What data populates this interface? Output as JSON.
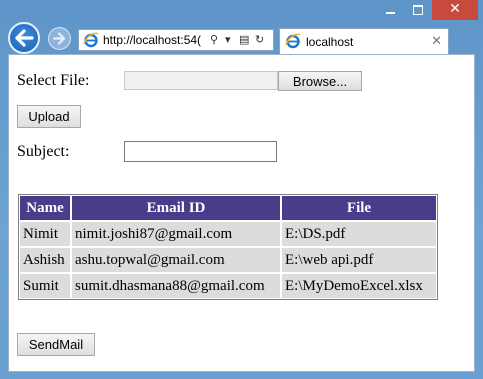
{
  "browser": {
    "url": "http://localhost:54(",
    "url_host": "http://localhost:54(",
    "tab_title": "localhost",
    "window_controls": {
      "minimize": "–",
      "maximize": "□",
      "close": "✕"
    },
    "icons": [
      "back-arrow-icon",
      "forward-arrow-icon",
      "ie-logo-icon",
      "search-icon",
      "dropdown-icon",
      "compat-view-icon",
      "refresh-icon",
      "close-icon"
    ]
  },
  "form": {
    "select_file_label": "Select File:",
    "browse_label": "Browse...",
    "file_value": "",
    "upload_label": "Upload",
    "subject_label": "Subject:",
    "subject_value": "",
    "send_label": "SendMail"
  },
  "table": {
    "headers": [
      "Name",
      "Email ID",
      "File"
    ],
    "rows": [
      [
        "Nimit",
        "nimit.joshi87@gmail.com",
        "E:\\DS.pdf"
      ],
      [
        "Ashish",
        "ashu.topwal@gmail.com",
        "E:\\web api.pdf"
      ],
      [
        "Sumit",
        "sumit.dhasmana88@gmail.com",
        "E:\\MyDemoExcel.xlsx"
      ]
    ]
  },
  "colors": {
    "header_bg": "#483d8b",
    "row_bg": "#dcdcdc",
    "chrome_blue": "#6b9ccd",
    "close_red": "#c74a3c"
  }
}
